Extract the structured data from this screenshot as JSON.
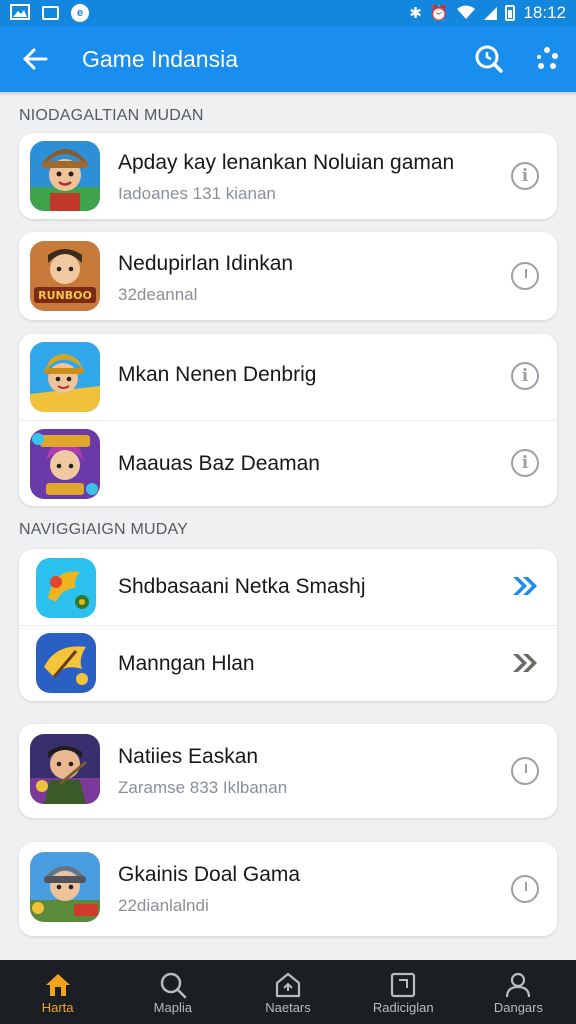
{
  "status_bar": {
    "time": "18:12"
  },
  "app_bar": {
    "title": "Game Indansia"
  },
  "sections": [
    {
      "header": "NIODAGALTIAN MUDAN",
      "items": [
        {
          "title": "Apday kay lenankan Noluian gaman",
          "subtitle": "Iadoanes 131 kianan",
          "trailing": "info-icon"
        },
        {
          "title": "Nedupirlan Idinkan",
          "subtitle": "32deannal",
          "trailing": "clock-icon"
        },
        {
          "title": "Mkan Nenen Denbrig",
          "subtitle": "",
          "trailing": "info-icon"
        },
        {
          "title": "Maauas Baz Deaman",
          "subtitle": "",
          "trailing": "info-icon"
        }
      ]
    },
    {
      "header": "NAVIGGIAIGN MUDAY",
      "items": [
        {
          "title": "Shdbasaani Netka Smashj",
          "subtitle": "",
          "trailing": "double-chevron-icon",
          "trailing_color": "#1a8eee"
        },
        {
          "title": "Manngan Hlan",
          "subtitle": "",
          "trailing": "double-chevron-icon",
          "trailing_color": "#6b6a64"
        },
        {
          "title": "Natiies Easkan",
          "subtitle": "Zaramse 833 Iklbanan",
          "trailing": "clock-icon"
        },
        {
          "title": "Gkainis Doal Gama",
          "subtitle": "22dianlalndi",
          "trailing": "clock-icon"
        }
      ]
    }
  ],
  "bottom_nav": [
    {
      "label": "Harta",
      "icon": "home-icon",
      "active": true
    },
    {
      "label": "Maplia",
      "icon": "search-icon",
      "active": false
    },
    {
      "label": "Naetars",
      "icon": "house-outline-icon",
      "active": false
    },
    {
      "label": "Radiciglan",
      "icon": "square-icon",
      "active": false
    },
    {
      "label": "Dangars",
      "icon": "profile-icon",
      "active": false
    }
  ],
  "colors": {
    "primary": "#1a8eee",
    "status_bar": "#1287dd",
    "nav_bg": "#1b1e22",
    "nav_active": "#f2a41c"
  }
}
